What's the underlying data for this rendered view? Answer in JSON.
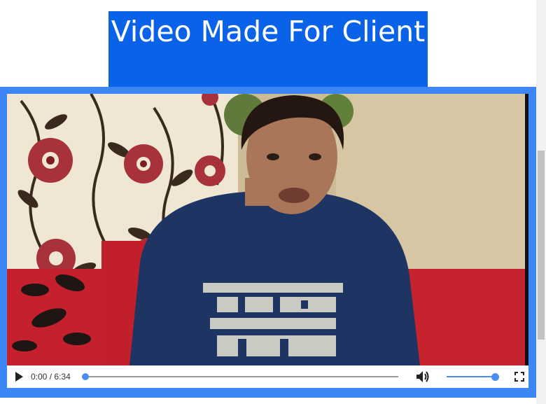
{
  "page": {
    "title": "Video Made For Client"
  },
  "player": {
    "current_time": "0:00",
    "time_separator": "/",
    "duration": "6:34",
    "progress": 0,
    "volume": 1.0,
    "icons": {
      "play": "play-icon",
      "volume": "volume-icon",
      "fullscreen": "fullscreen-icon"
    }
  },
  "colors": {
    "title_bg": "#0a62e8",
    "frame": "#3d86f5",
    "accent": "#4b8cf5",
    "text": "#ffffff"
  }
}
